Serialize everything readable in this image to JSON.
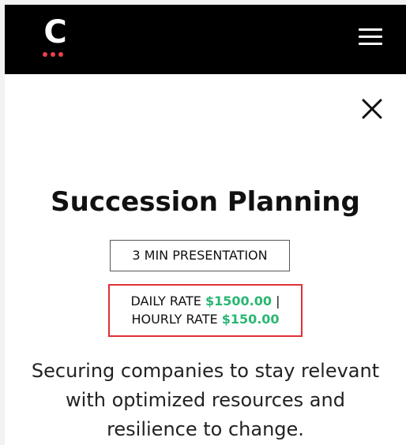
{
  "header": {
    "logo_letter": "C",
    "logo_icon": "company-logo",
    "menu_icon": "hamburger-menu-icon",
    "background_color": "#000000",
    "dot_color": "#e8424c"
  },
  "close_icon": "close-icon",
  "service": {
    "title": "Succession Planning",
    "duration_label": "3 MIN PRESENTATION",
    "daily_rate_label": "DAILY RATE",
    "daily_rate_value": "$1500.00",
    "separator": "|",
    "hourly_rate_label": "HOURLY RATE",
    "hourly_rate_value": "$150.00",
    "description": "Securing companies to stay relevant with optimized resources and resilience to change."
  },
  "colors": {
    "rate_value": "#2bb673",
    "rate_border": "#e03035"
  }
}
